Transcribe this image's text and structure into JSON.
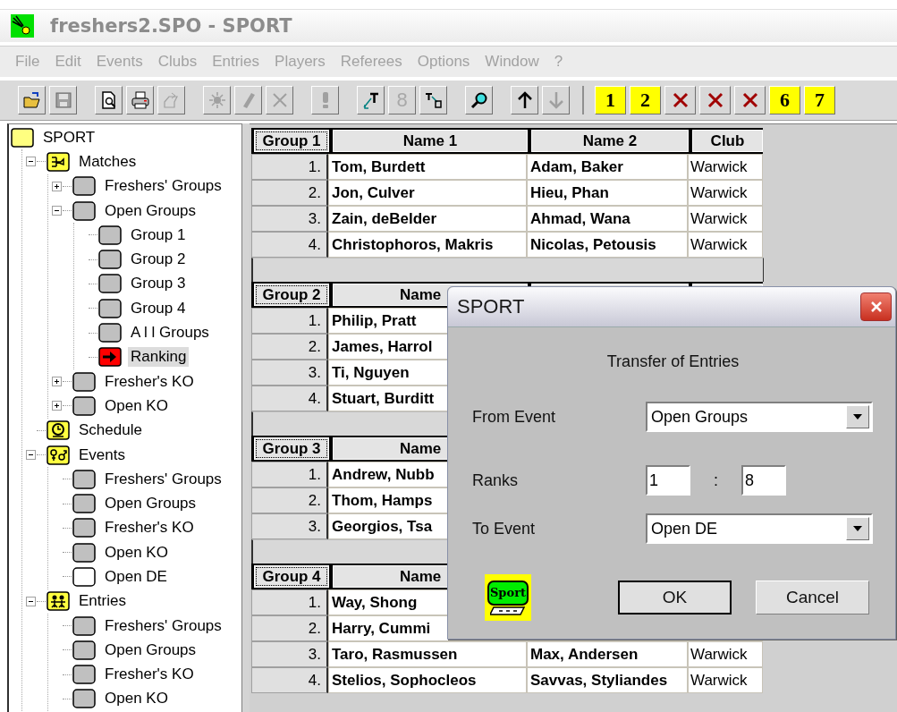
{
  "window": {
    "title": "freshers2.SPO - SPORT",
    "active": false
  },
  "menu": [
    {
      "label": "File",
      "disabled": true
    },
    {
      "label": "Edit",
      "disabled": true
    },
    {
      "label": "Events",
      "disabled": true
    },
    {
      "label": "Clubs",
      "disabled": true
    },
    {
      "label": "Entries",
      "disabled": true
    },
    {
      "label": "Players",
      "disabled": true
    },
    {
      "label": "Referees",
      "disabled": true
    },
    {
      "label": "Options",
      "disabled": true
    },
    {
      "label": "Window",
      "disabled": true
    },
    {
      "label": "?",
      "disabled": true
    }
  ],
  "toolbars": [
    {
      "groups": [
        [
          {
            "kind": "open",
            "disabled": false
          },
          {
            "kind": "save",
            "disabled": true
          }
        ],
        [
          {
            "kind": "preview",
            "disabled": false
          },
          {
            "kind": "print",
            "disabled": false
          },
          {
            "kind": "export",
            "disabled": true
          }
        ],
        [
          {
            "kind": "sun",
            "disabled": true
          },
          {
            "kind": "pen",
            "disabled": true
          },
          {
            "kind": "cross",
            "disabled": true
          }
        ],
        [
          {
            "kind": "exclaim",
            "disabled": true
          }
        ],
        [
          {
            "kind": "arrow-t",
            "disabled": false
          },
          {
            "kind": "label",
            "label": "8",
            "disabled": true
          },
          {
            "kind": "t-arrow",
            "disabled": false
          }
        ],
        [
          {
            "kind": "search",
            "disabled": false
          }
        ],
        [
          {
            "kind": "up",
            "disabled": false
          },
          {
            "kind": "down",
            "disabled": true
          }
        ]
      ]
    },
    {
      "groups": [
        [
          {
            "kind": "number",
            "label": "1",
            "disabled": false
          },
          {
            "kind": "number",
            "label": "2",
            "disabled": false
          },
          {
            "kind": "red-cross",
            "disabled": false
          },
          {
            "kind": "red-cross",
            "disabled": false
          },
          {
            "kind": "red-cross",
            "disabled": false
          },
          {
            "kind": "number",
            "label": "6",
            "disabled": false
          },
          {
            "kind": "number",
            "label": "7",
            "disabled": false
          }
        ]
      ]
    }
  ],
  "tree": [
    {
      "label": "SPORT",
      "kind": "root",
      "selected": false,
      "children": [
        {
          "label": "Matches",
          "kind": "matches",
          "selected": false,
          "expanded": true,
          "children": [
            {
              "label": "Freshers' Groups",
              "kind": "grey",
              "selected": false,
              "expanded": false
            },
            {
              "label": "Open Groups",
              "kind": "grey",
              "selected": false,
              "expanded": true,
              "children": [
                {
                  "label": "Group 1",
                  "kind": "grey",
                  "selected": false
                },
                {
                  "label": "Group 2",
                  "kind": "grey",
                  "selected": false
                },
                {
                  "label": "Group 3",
                  "kind": "grey",
                  "selected": false
                },
                {
                  "label": "Group 4",
                  "kind": "grey",
                  "selected": false
                },
                {
                  "label": "A l l Groups",
                  "kind": "grey",
                  "selected": false
                },
                {
                  "label": "Ranking",
                  "kind": "ranking",
                  "selected": true
                }
              ]
            },
            {
              "label": "Fresher's KO",
              "kind": "grey",
              "selected": false,
              "expanded": false
            },
            {
              "label": "Open KO",
              "kind": "grey",
              "selected": false,
              "expanded": false
            }
          ]
        },
        {
          "label": "Schedule",
          "kind": "schedule",
          "selected": false
        },
        {
          "label": "Events",
          "kind": "events",
          "selected": false,
          "expanded": true,
          "children": [
            {
              "label": "Freshers' Groups",
              "kind": "grey",
              "selected": false
            },
            {
              "label": "Open Groups",
              "kind": "grey",
              "selected": false
            },
            {
              "label": "Fresher's KO",
              "kind": "grey",
              "selected": false
            },
            {
              "label": "Open KO",
              "kind": "grey",
              "selected": false
            },
            {
              "label": "Open DE",
              "kind": "white",
              "selected": false
            }
          ]
        },
        {
          "label": "Entries",
          "kind": "entries",
          "selected": false,
          "expanded": true,
          "children": [
            {
              "label": "Freshers' Groups",
              "kind": "grey",
              "selected": false
            },
            {
              "label": "Open Groups",
              "kind": "grey",
              "selected": false
            },
            {
              "label": "Fresher's KO",
              "kind": "grey",
              "selected": false
            },
            {
              "label": "Open KO",
              "kind": "grey",
              "selected": false
            }
          ]
        }
      ]
    }
  ],
  "groups": [
    {
      "title": "Group 1",
      "columns": [
        "Name 1",
        "Name 2",
        "Club"
      ],
      "rows": [
        {
          "rank": "1.",
          "name_1": "Tom, Burdett",
          "name_2": "Adam, Baker",
          "club": "Warwick"
        },
        {
          "rank": "2.",
          "name_1": "Jon, Culver",
          "name_2": "Hieu, Phan",
          "club": "Warwick"
        },
        {
          "rank": "3.",
          "name_1": "Zain, deBelder",
          "name_2": "Ahmad, Wana",
          "club": "Warwick"
        },
        {
          "rank": "4.",
          "name_1": "Christophoros, Makris",
          "name_2": "Nicolas, Petousis",
          "club": "Warwick"
        }
      ]
    },
    {
      "title": "Group 2",
      "columns": [
        "Name"
      ],
      "rows": [
        {
          "rank": "1.",
          "name_1": "Philip, Pratt"
        },
        {
          "rank": "2.",
          "name_1": "James, Harrol"
        },
        {
          "rank": "3.",
          "name_1": "Ti, Nguyen"
        },
        {
          "rank": "4.",
          "name_1": "Stuart, Burditt"
        }
      ]
    },
    {
      "title": "Group 3",
      "columns": [
        "Name"
      ],
      "rows": [
        {
          "rank": "1.",
          "name_1": "Andrew, Nubb"
        },
        {
          "rank": "2.",
          "name_1": "Thom, Hamps"
        },
        {
          "rank": "3.",
          "name_1": "Georgios, Tsa"
        }
      ]
    },
    {
      "title": "Group 4",
      "columns": [
        "Name"
      ],
      "rows": [
        {
          "rank": "1.",
          "name_1": "Way, Shong"
        },
        {
          "rank": "2.",
          "name_1": "Harry, Cummi"
        },
        {
          "rank": "3.",
          "name_1": "Taro, Rasmussen",
          "name_2": "Max, Andersen",
          "club": "Warwick"
        },
        {
          "rank": "4.",
          "name_1": "Stelios, Sophocleos",
          "name_2": "Savvas, Styliandes",
          "club": "Warwick"
        }
      ]
    }
  ],
  "dialog": {
    "title": "SPORT",
    "heading": "Transfer of Entries",
    "fields": [
      {
        "kind": "combo",
        "label": "From Event",
        "value": "Open Groups"
      },
      {
        "kind": "range",
        "label": "Ranks",
        "from": "1",
        "separator": ":",
        "to": "8"
      },
      {
        "kind": "combo",
        "label": "To Event",
        "value": "Open DE"
      }
    ],
    "logo_text": "Sport",
    "buttons": [
      {
        "label": "OK",
        "default": true
      },
      {
        "label": "Cancel",
        "default": false
      }
    ]
  }
}
